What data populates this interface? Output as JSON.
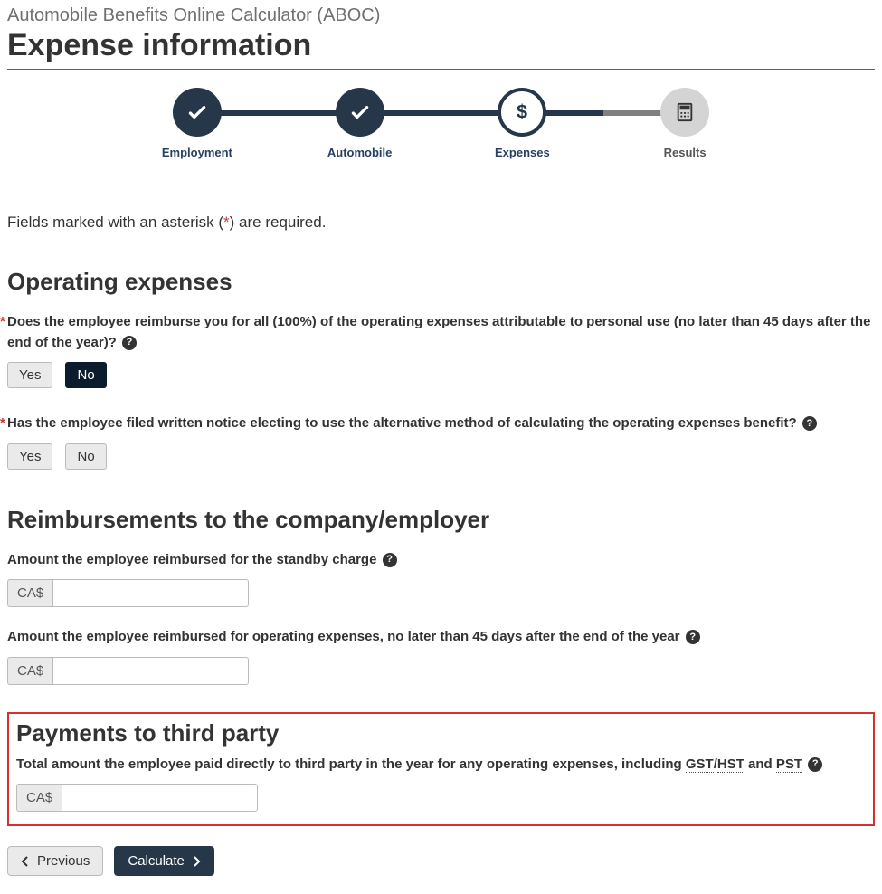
{
  "header": {
    "app_title": "Automobile Benefits Online Calculator (ABOC)",
    "page_title": "Expense information"
  },
  "stepper": {
    "steps": [
      {
        "label": "Employment",
        "state": "done"
      },
      {
        "label": "Automobile",
        "state": "done"
      },
      {
        "label": "Expenses",
        "state": "current"
      },
      {
        "label": "Results",
        "state": "future"
      }
    ]
  },
  "required_note": {
    "prefix": "Fields marked with an asterisk (",
    "star": "*",
    "suffix": ") are required."
  },
  "operating": {
    "heading": "Operating expenses",
    "q1": "Does the employee reimburse you for all (100%) of the operating expenses attributable to personal use (no later than 45 days after the end of the year)?",
    "q1_yes": "Yes",
    "q1_no": "No",
    "q1_selected": "No",
    "q2": "Has the employee filed written notice electing to use the alternative method of calculating the operating expenses benefit?",
    "q2_yes": "Yes",
    "q2_no": "No",
    "q2_selected": ""
  },
  "reimbursements": {
    "heading": "Reimbursements to the company/employer",
    "standby_label": "Amount the employee reimbursed for the standby charge",
    "opex_label": "Amount the employee reimbursed for operating expenses, no later than 45 days after the end of the year",
    "currency_prefix": "CA$",
    "standby_value": "",
    "opex_value": ""
  },
  "third_party": {
    "heading": "Payments to third party",
    "label_pre": "Total amount the employee paid directly to third party in the year for any operating expenses, including ",
    "gst": "GST",
    "slash": "/",
    "hst": "HST",
    "and": " and ",
    "pst": "PST",
    "currency_prefix": "CA$",
    "value": ""
  },
  "footer": {
    "previous": "Previous",
    "calculate": "Calculate"
  }
}
